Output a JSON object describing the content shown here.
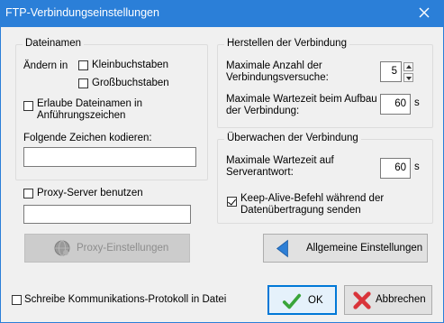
{
  "window": {
    "title": "FTP-Verbindungseinstellungen"
  },
  "filenames": {
    "legend": "Dateinamen",
    "change_in": "Ändern in",
    "lowercase": {
      "label": "Kleinbuchstaben",
      "checked": false
    },
    "uppercase": {
      "label": "Großbuchstaben",
      "checked": false
    },
    "allow_quotes": {
      "label_line1": "Erlaube Dateinamen in",
      "label_line2": "Anführungszeichen",
      "checked": false
    },
    "encode_label": "Folgende Zeichen kodieren:",
    "encode_value": ""
  },
  "proxy": {
    "checkbox_label": "Proxy-Server benutzen",
    "checked": false,
    "input_value": "",
    "settings_button": "Proxy-Einstellungen"
  },
  "connect": {
    "legend": "Herstellen der Verbindung",
    "max_attempts_line1": "Maximale Anzahl der",
    "max_attempts_line2": "Verbindungsversuche:",
    "max_attempts_value": "5",
    "max_wait_line1": "Maximale Wartezeit beim Aufbau",
    "max_wait_line2": "der Verbindung:",
    "max_wait_value": "60",
    "max_wait_unit": "s"
  },
  "monitor": {
    "legend": "Überwachen der Verbindung",
    "server_wait_line1": "Maximale Wartezeit auf",
    "server_wait_line2": "Serverantwort:",
    "server_wait_value": "60",
    "server_wait_unit": "s",
    "keepalive_line1": "Keep-Alive-Befehl während der",
    "keepalive_line2": "Datenübertragung senden",
    "keepalive_checked": true
  },
  "general_button": "Allgemeine Einstellungen",
  "log": {
    "label": "Schreibe Kommunikations-Protokoll in Datei",
    "checked": false
  },
  "ok_button": "OK",
  "cancel_button": "Abbrechen",
  "colors": {
    "titlebar": "#2b7fd8",
    "ok_check": "#3aa53a",
    "cancel_x": "#d9343a",
    "back_arrow": "#2e7fd6"
  }
}
